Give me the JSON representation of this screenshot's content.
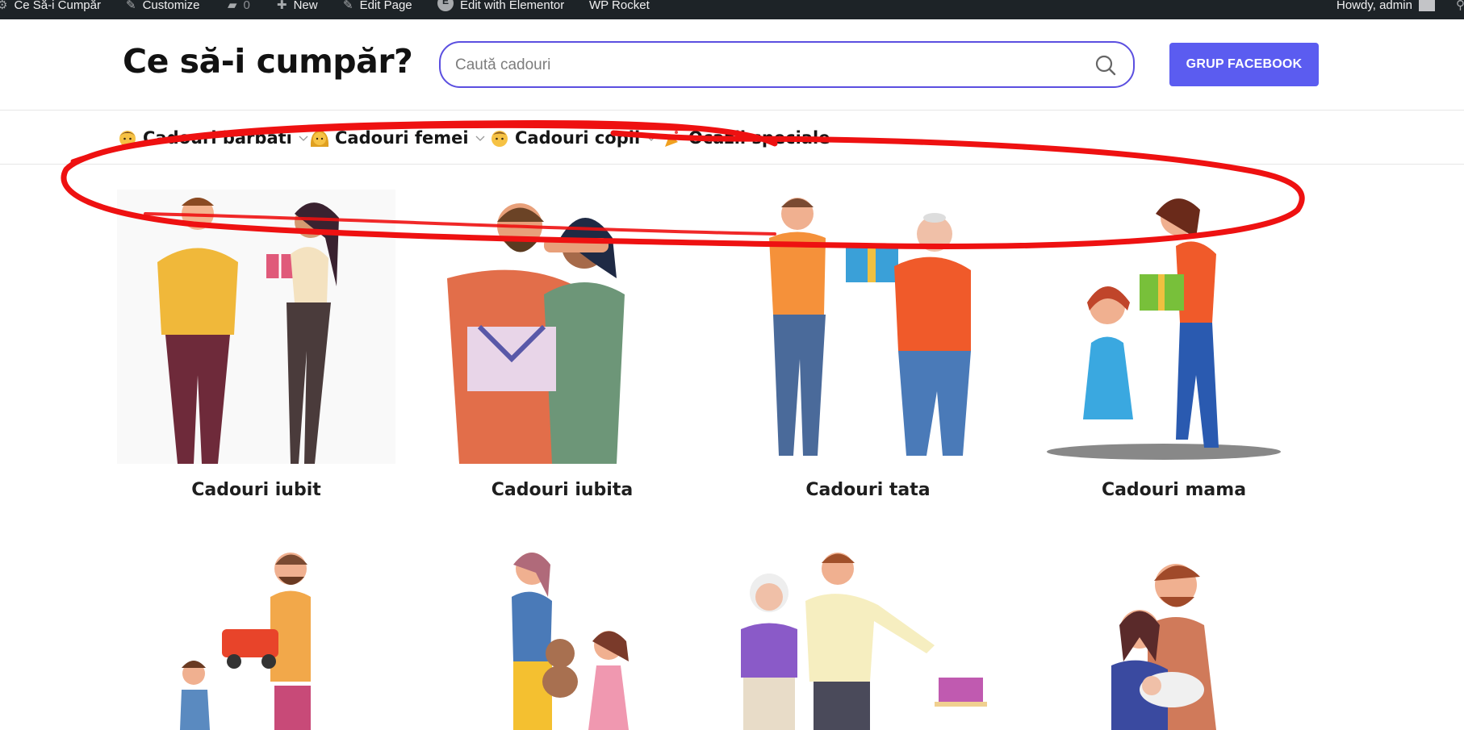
{
  "admin_bar": {
    "site_name": "Ce Să-i Cumpăr",
    "customize": "Customize",
    "comments_count": "0",
    "new": "New",
    "edit_page": "Edit Page",
    "edit_elementor": "Edit with Elementor",
    "wp_rocket": "WP Rocket",
    "howdy": "Howdy, admin"
  },
  "header": {
    "title": "Ce să-i cumpăr?",
    "search_placeholder": "Caută cadouri",
    "facebook_button": "GRUP FACEBOOK"
  },
  "nav": {
    "items": [
      {
        "label": "Cadouri barbati",
        "icon": "man-emoji-icon"
      },
      {
        "label": "Cadouri femei",
        "icon": "woman-emoji-icon"
      },
      {
        "label": "Cadouri copii",
        "icon": "child-emoji-icon"
      },
      {
        "label": "Ocazii speciale",
        "icon": "party-popper-icon"
      }
    ]
  },
  "grid": {
    "cards": [
      {
        "title": "Cadouri iubit"
      },
      {
        "title": "Cadouri iubita"
      },
      {
        "title": "Cadouri tata"
      },
      {
        "title": "Cadouri mama"
      },
      {
        "title": ""
      },
      {
        "title": ""
      },
      {
        "title": ""
      },
      {
        "title": ""
      }
    ]
  },
  "colors": {
    "accent": "#5b5cf0",
    "search_border": "#5b4fe0",
    "admin_bar": "#1d2327",
    "annotation": "#ee1111"
  }
}
